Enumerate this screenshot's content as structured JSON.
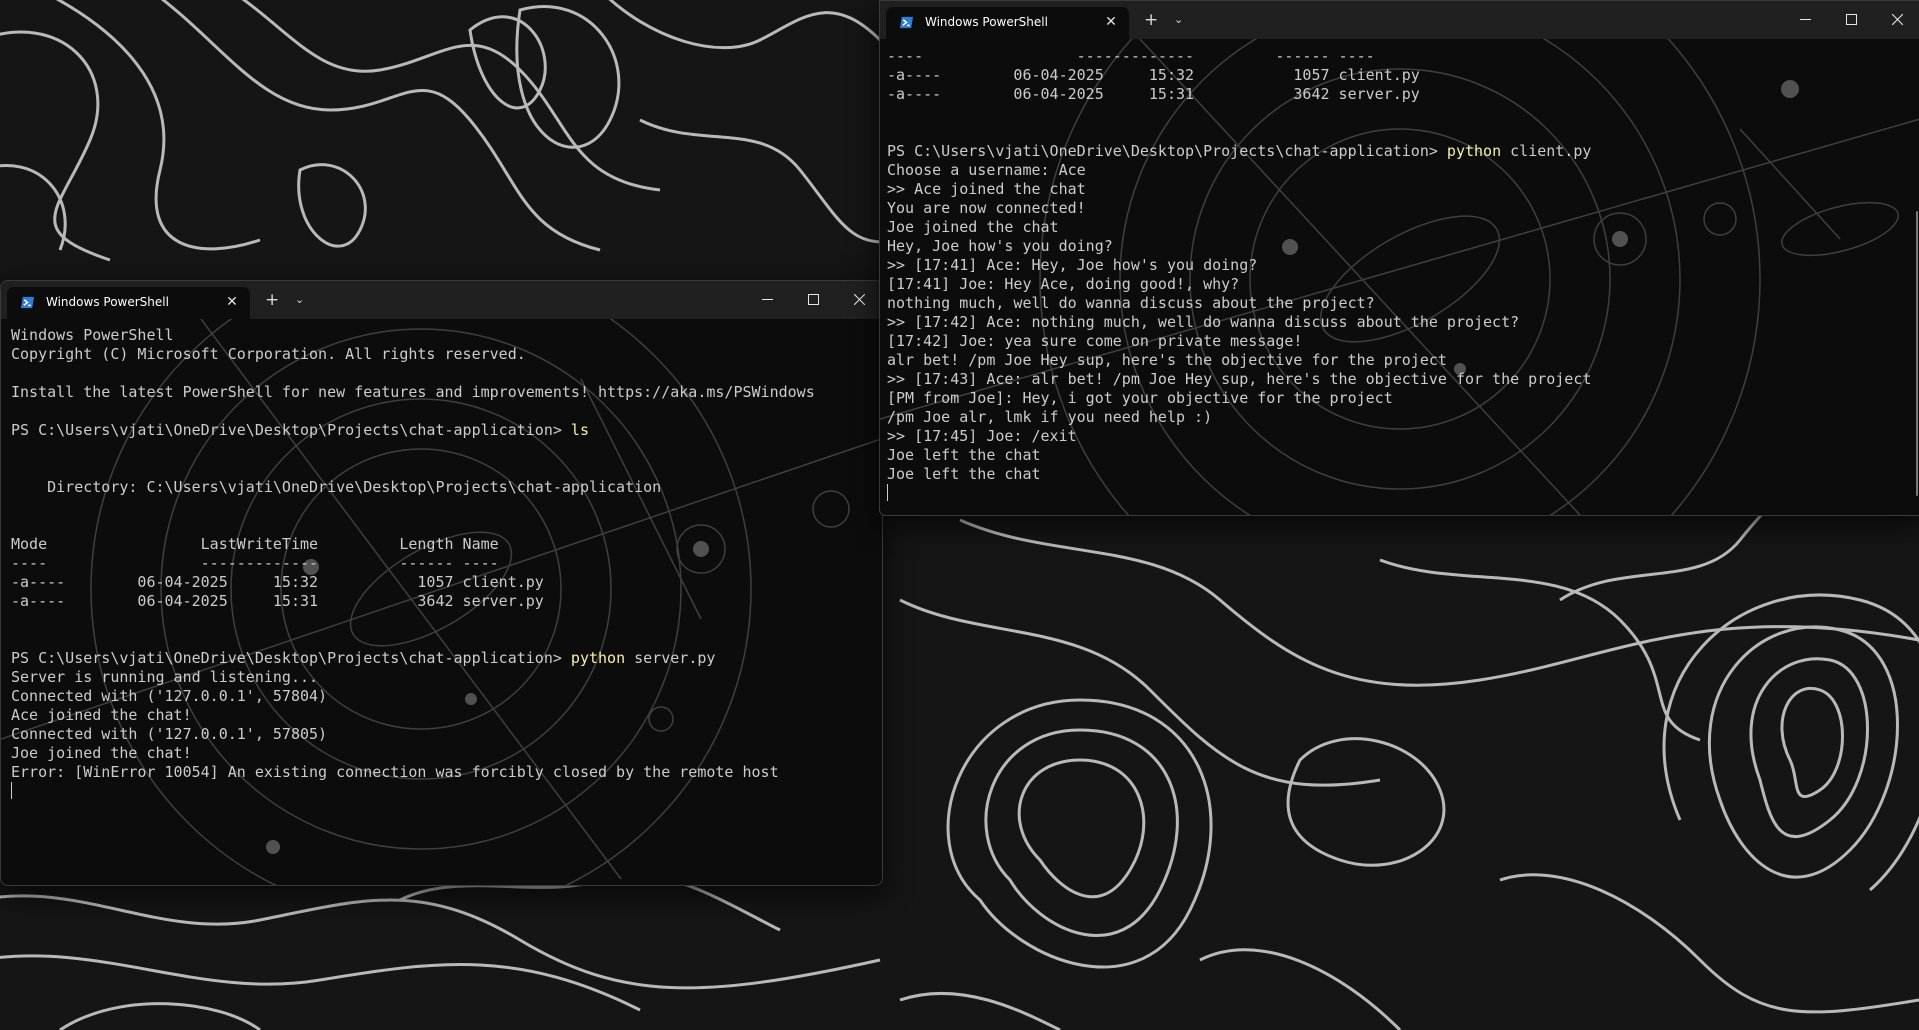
{
  "windows": {
    "server": {
      "tab_title": "Windows PowerShell",
      "icon": "powershell-icon",
      "lines": [
        "Windows PowerShell",
        "Copyright (C) Microsoft Corporation. All rights reserved.",
        "",
        "Install the latest PowerShell for new features and improvements! https://aka.ms/PSWindows",
        "",
        "PS C:\\Users\\vjati\\OneDrive\\Desktop\\Projects\\chat-application> ",
        "",
        "",
        "    Directory: C:\\Users\\vjati\\OneDrive\\Desktop\\Projects\\chat-application",
        "",
        "",
        "Mode                 LastWriteTime         Length Name",
        "----                 -------------         ------ ----",
        "-a----        06-04-2025     15:32           1057 client.py",
        "-a----        06-04-2025     15:31           3642 server.py",
        "",
        "",
        "PS C:\\Users\\vjati\\OneDrive\\Desktop\\Projects\\chat-application> ",
        "Server is running and listening...",
        "Connected with ('127.0.0.1', 57804)",
        "Ace joined the chat!",
        "Connected with ('127.0.0.1', 57805)",
        "Joe joined the chat!",
        "Error: [WinError 10054] An existing connection was forcibly closed by the remote host"
      ],
      "commands": {
        "5": "ls",
        "17": "python"
      },
      "args": {
        "17": " server.py"
      }
    },
    "client": {
      "tab_title": "Windows PowerShell",
      "icon": "powershell-icon",
      "lines": [
        "----                 -------------         ------ ----",
        "-a----        06-04-2025     15:32           1057 client.py",
        "-a----        06-04-2025     15:31           3642 server.py",
        "",
        "",
        "PS C:\\Users\\vjati\\OneDrive\\Desktop\\Projects\\chat-application> ",
        "Choose a username: Ace",
        ">> Ace joined the chat",
        "You are now connected!",
        "Joe joined the chat",
        "Hey, Joe how's you doing?",
        ">> [17:41] Ace: Hey, Joe how's you doing?",
        "[17:41] Joe: Hey Ace, doing good!, why?",
        "nothing much, well do wanna discuss about the project?",
        ">> [17:42] Ace: nothing much, well do wanna discuss about the project?",
        "[17:42] Joe: yea sure come on private message!",
        "alr bet! /pm Joe Hey sup, here's the objective for the project",
        ">> [17:43] Ace: alr bet! /pm Joe Hey sup, here's the objective for the project",
        "[PM from Joe]: Hey, i got your objective for the project",
        "/pm Joe alr, lmk if you need help :)",
        ">> [17:45] Joe: /exit",
        "Joe left the chat",
        "Joe left the chat"
      ],
      "commands": {
        "5": "python"
      },
      "args": {
        "5": " client.py"
      }
    }
  },
  "colors": {
    "terminal_bg": "#0c0c0c",
    "terminal_fg": "#cccccc",
    "command": "#f9f1a5",
    "titlebar": "#202020",
    "wallpaper_bg": "#151515",
    "wallpaper_lines": "#d8d8d8"
  }
}
